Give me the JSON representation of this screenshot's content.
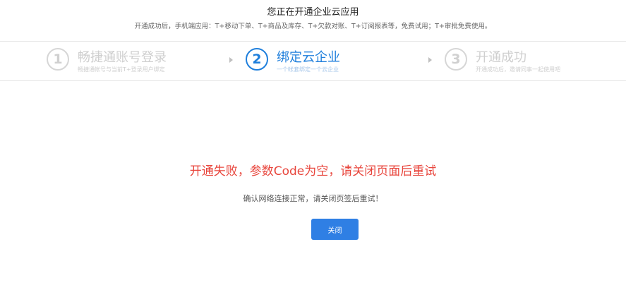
{
  "header": {
    "title": "您正在开通企业云应用",
    "subtitle": "开通成功后，手机端应用：T+移动下单、T+商品及库存、T+欠款对账、T+订阅报表等，免费试用；T+审批免费使用。"
  },
  "steps": [
    {
      "number": "1",
      "name": "畅捷通账号登录",
      "desc": "畅捷通帐号与当前T+登录用户绑定",
      "state": "done"
    },
    {
      "number": "2",
      "name": "绑定云企业",
      "desc": "一个帐套绑定一个云企业",
      "state": "active"
    },
    {
      "number": "3",
      "name": "开通成功",
      "desc": "开通成功后，邀请同事一起使用吧",
      "state": "pending"
    }
  ],
  "colors": {
    "accent": "#1f7fdc",
    "error": "#e8453c",
    "button": "#2f7fe4",
    "inactive": "#cfcfcf"
  },
  "message": {
    "error_title": "开通失败，参数Code为空，请关闭页面后重试",
    "error_detail": "确认网络连接正常，请关闭页签后重试！"
  },
  "actions": {
    "close_label": "关闭"
  }
}
